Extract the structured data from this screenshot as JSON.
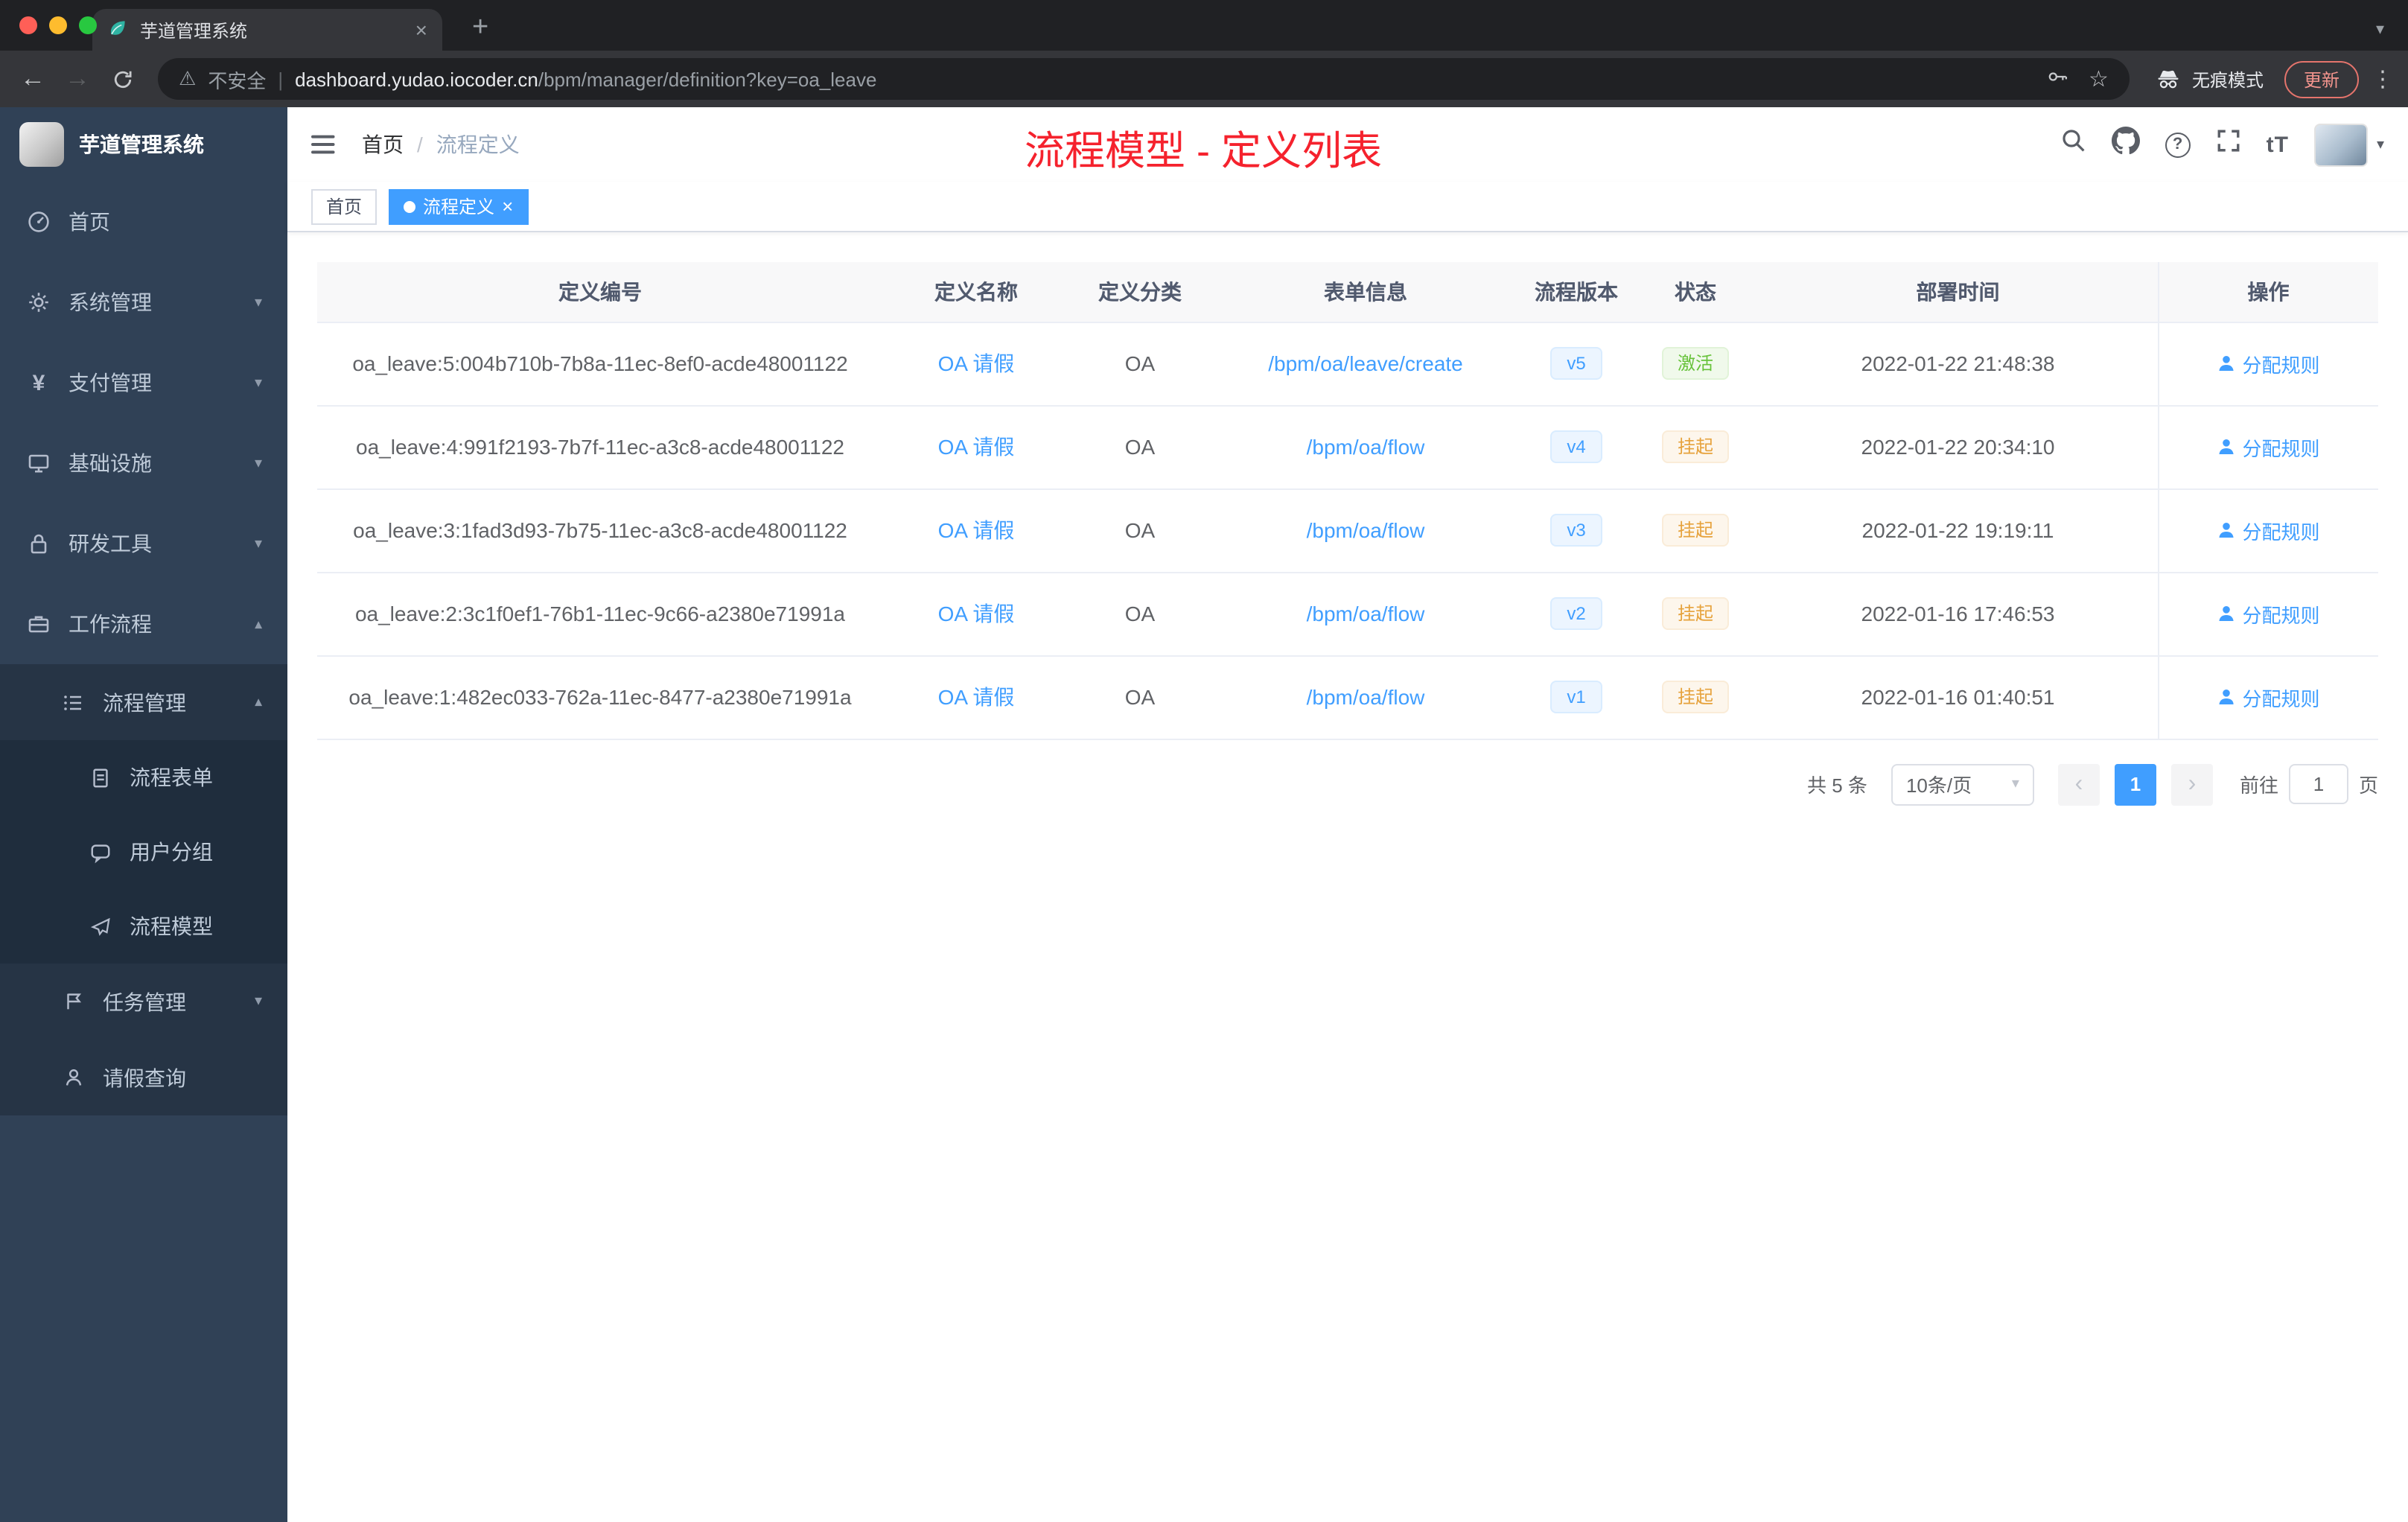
{
  "icons": {
    "close": "×",
    "plus": "+",
    "caret_down": "▾",
    "back": "←",
    "forward": "→",
    "warning": "⚠",
    "separator": "|",
    "star": "☆",
    "menu_dots": "⋮",
    "question": "?",
    "font_size": "tT",
    "breadcrumb_sep": "/",
    "yen": "¥",
    "prev": "‹",
    "next": "›"
  },
  "browser": {
    "tab_title": "芋道管理系统",
    "security_label": "不安全",
    "url_domain": "dashboard.yudao.iocoder.cn",
    "url_path": "/bpm/manager/definition?key=oa_leave",
    "incognito_label": "无痕模式",
    "update_label": "更新"
  },
  "sidebar": {
    "logo_title": "芋道管理系统",
    "items": [
      {
        "label": "首页"
      },
      {
        "label": "系统管理"
      },
      {
        "label": "支付管理"
      },
      {
        "label": "基础设施"
      },
      {
        "label": "研发工具"
      },
      {
        "label": "工作流程"
      },
      {
        "label": "流程管理"
      },
      {
        "label": "流程表单"
      },
      {
        "label": "用户分组"
      },
      {
        "label": "流程模型"
      },
      {
        "label": "任务管理"
      },
      {
        "label": "请假查询"
      }
    ]
  },
  "header": {
    "breadcrumb_home": "首页",
    "breadcrumb_current": "流程定义",
    "annotation": "流程模型 - 定义列表"
  },
  "tags": {
    "home": "首页",
    "current": "流程定义"
  },
  "table": {
    "columns": [
      "定义编号",
      "定义名称",
      "定义分类",
      "表单信息",
      "流程版本",
      "状态",
      "部署时间",
      "操作"
    ],
    "rows": [
      {
        "id": "oa_leave:5:004b710b-7b8a-11ec-8ef0-acde48001122",
        "name": "OA 请假",
        "category": "OA",
        "form": "/bpm/oa/leave/create",
        "version": "v5",
        "status": "激活",
        "time": "2022-01-22 21:48:38",
        "action": "分配规则"
      },
      {
        "id": "oa_leave:4:991f2193-7b7f-11ec-a3c8-acde48001122",
        "name": "OA 请假",
        "category": "OA",
        "form": "/bpm/oa/flow",
        "version": "v4",
        "status": "挂起",
        "time": "2022-01-22 20:34:10",
        "action": "分配规则"
      },
      {
        "id": "oa_leave:3:1fad3d93-7b75-11ec-a3c8-acde48001122",
        "name": "OA 请假",
        "category": "OA",
        "form": "/bpm/oa/flow",
        "version": "v3",
        "status": "挂起",
        "time": "2022-01-22 19:19:11",
        "action": "分配规则"
      },
      {
        "id": "oa_leave:2:3c1f0ef1-76b1-11ec-9c66-a2380e71991a",
        "name": "OA 请假",
        "category": "OA",
        "form": "/bpm/oa/flow",
        "version": "v2",
        "status": "挂起",
        "time": "2022-01-16 17:46:53",
        "action": "分配规则"
      },
      {
        "id": "oa_leave:1:482ec033-762a-11ec-8477-a2380e71991a",
        "name": "OA 请假",
        "category": "OA",
        "form": "/bpm/oa/flow",
        "version": "v1",
        "status": "挂起",
        "time": "2022-01-16 01:40:51",
        "action": "分配规则"
      }
    ]
  },
  "pagination": {
    "total": "共 5 条",
    "page_size": "10条/页",
    "current_page": "1",
    "goto_label": "前往",
    "goto_value": "1",
    "page_unit": "页"
  },
  "colors": {
    "accent": "#409eff",
    "success": "#67c23a",
    "warning": "#e6a23c",
    "annotation_red": "#f5222d",
    "sidebar_bg": "#304156"
  }
}
